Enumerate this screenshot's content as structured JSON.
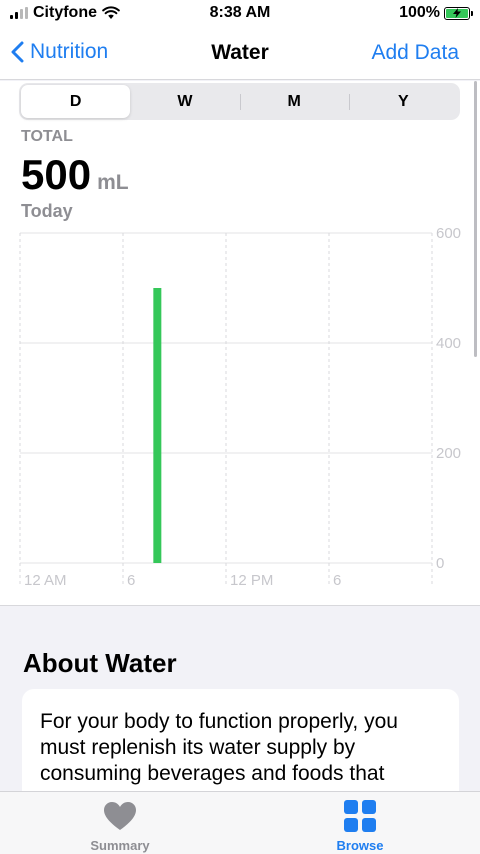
{
  "status": {
    "carrier": "Cityfone",
    "time": "8:38 AM",
    "battery_percent": "100%",
    "signal_bars": 2,
    "icons": [
      "signal-icon",
      "wifi-icon",
      "battery-charging-icon"
    ]
  },
  "nav": {
    "back_label": "Nutrition",
    "title": "Water",
    "action_label": "Add Data"
  },
  "segments": [
    "D",
    "W",
    "M",
    "Y"
  ],
  "selected_segment": "D",
  "summary": {
    "total_label": "TOTAL",
    "value": "500",
    "unit": "mL",
    "date": "Today"
  },
  "chart_data": {
    "type": "bar",
    "x": [
      "12 AM",
      "6",
      "12 PM",
      "6"
    ],
    "bar_hour": 8,
    "values": [
      500
    ],
    "ylim": [
      0,
      600
    ],
    "yticks": [
      "600",
      "400",
      "200",
      "0"
    ],
    "bar_color": "#34c759",
    "grid": true
  },
  "about": {
    "title": "About Water",
    "text": "For your body to function properly, you must replenish its water supply by consuming beverages and foods that"
  },
  "tabs": [
    {
      "label": "Summary",
      "icon": "heart-icon",
      "active": false
    },
    {
      "label": "Browse",
      "icon": "grid-icon",
      "active": true
    }
  ],
  "colors": {
    "accent": "#1f7ef0",
    "bar": "#34c759",
    "inactive": "#8e8e93"
  }
}
